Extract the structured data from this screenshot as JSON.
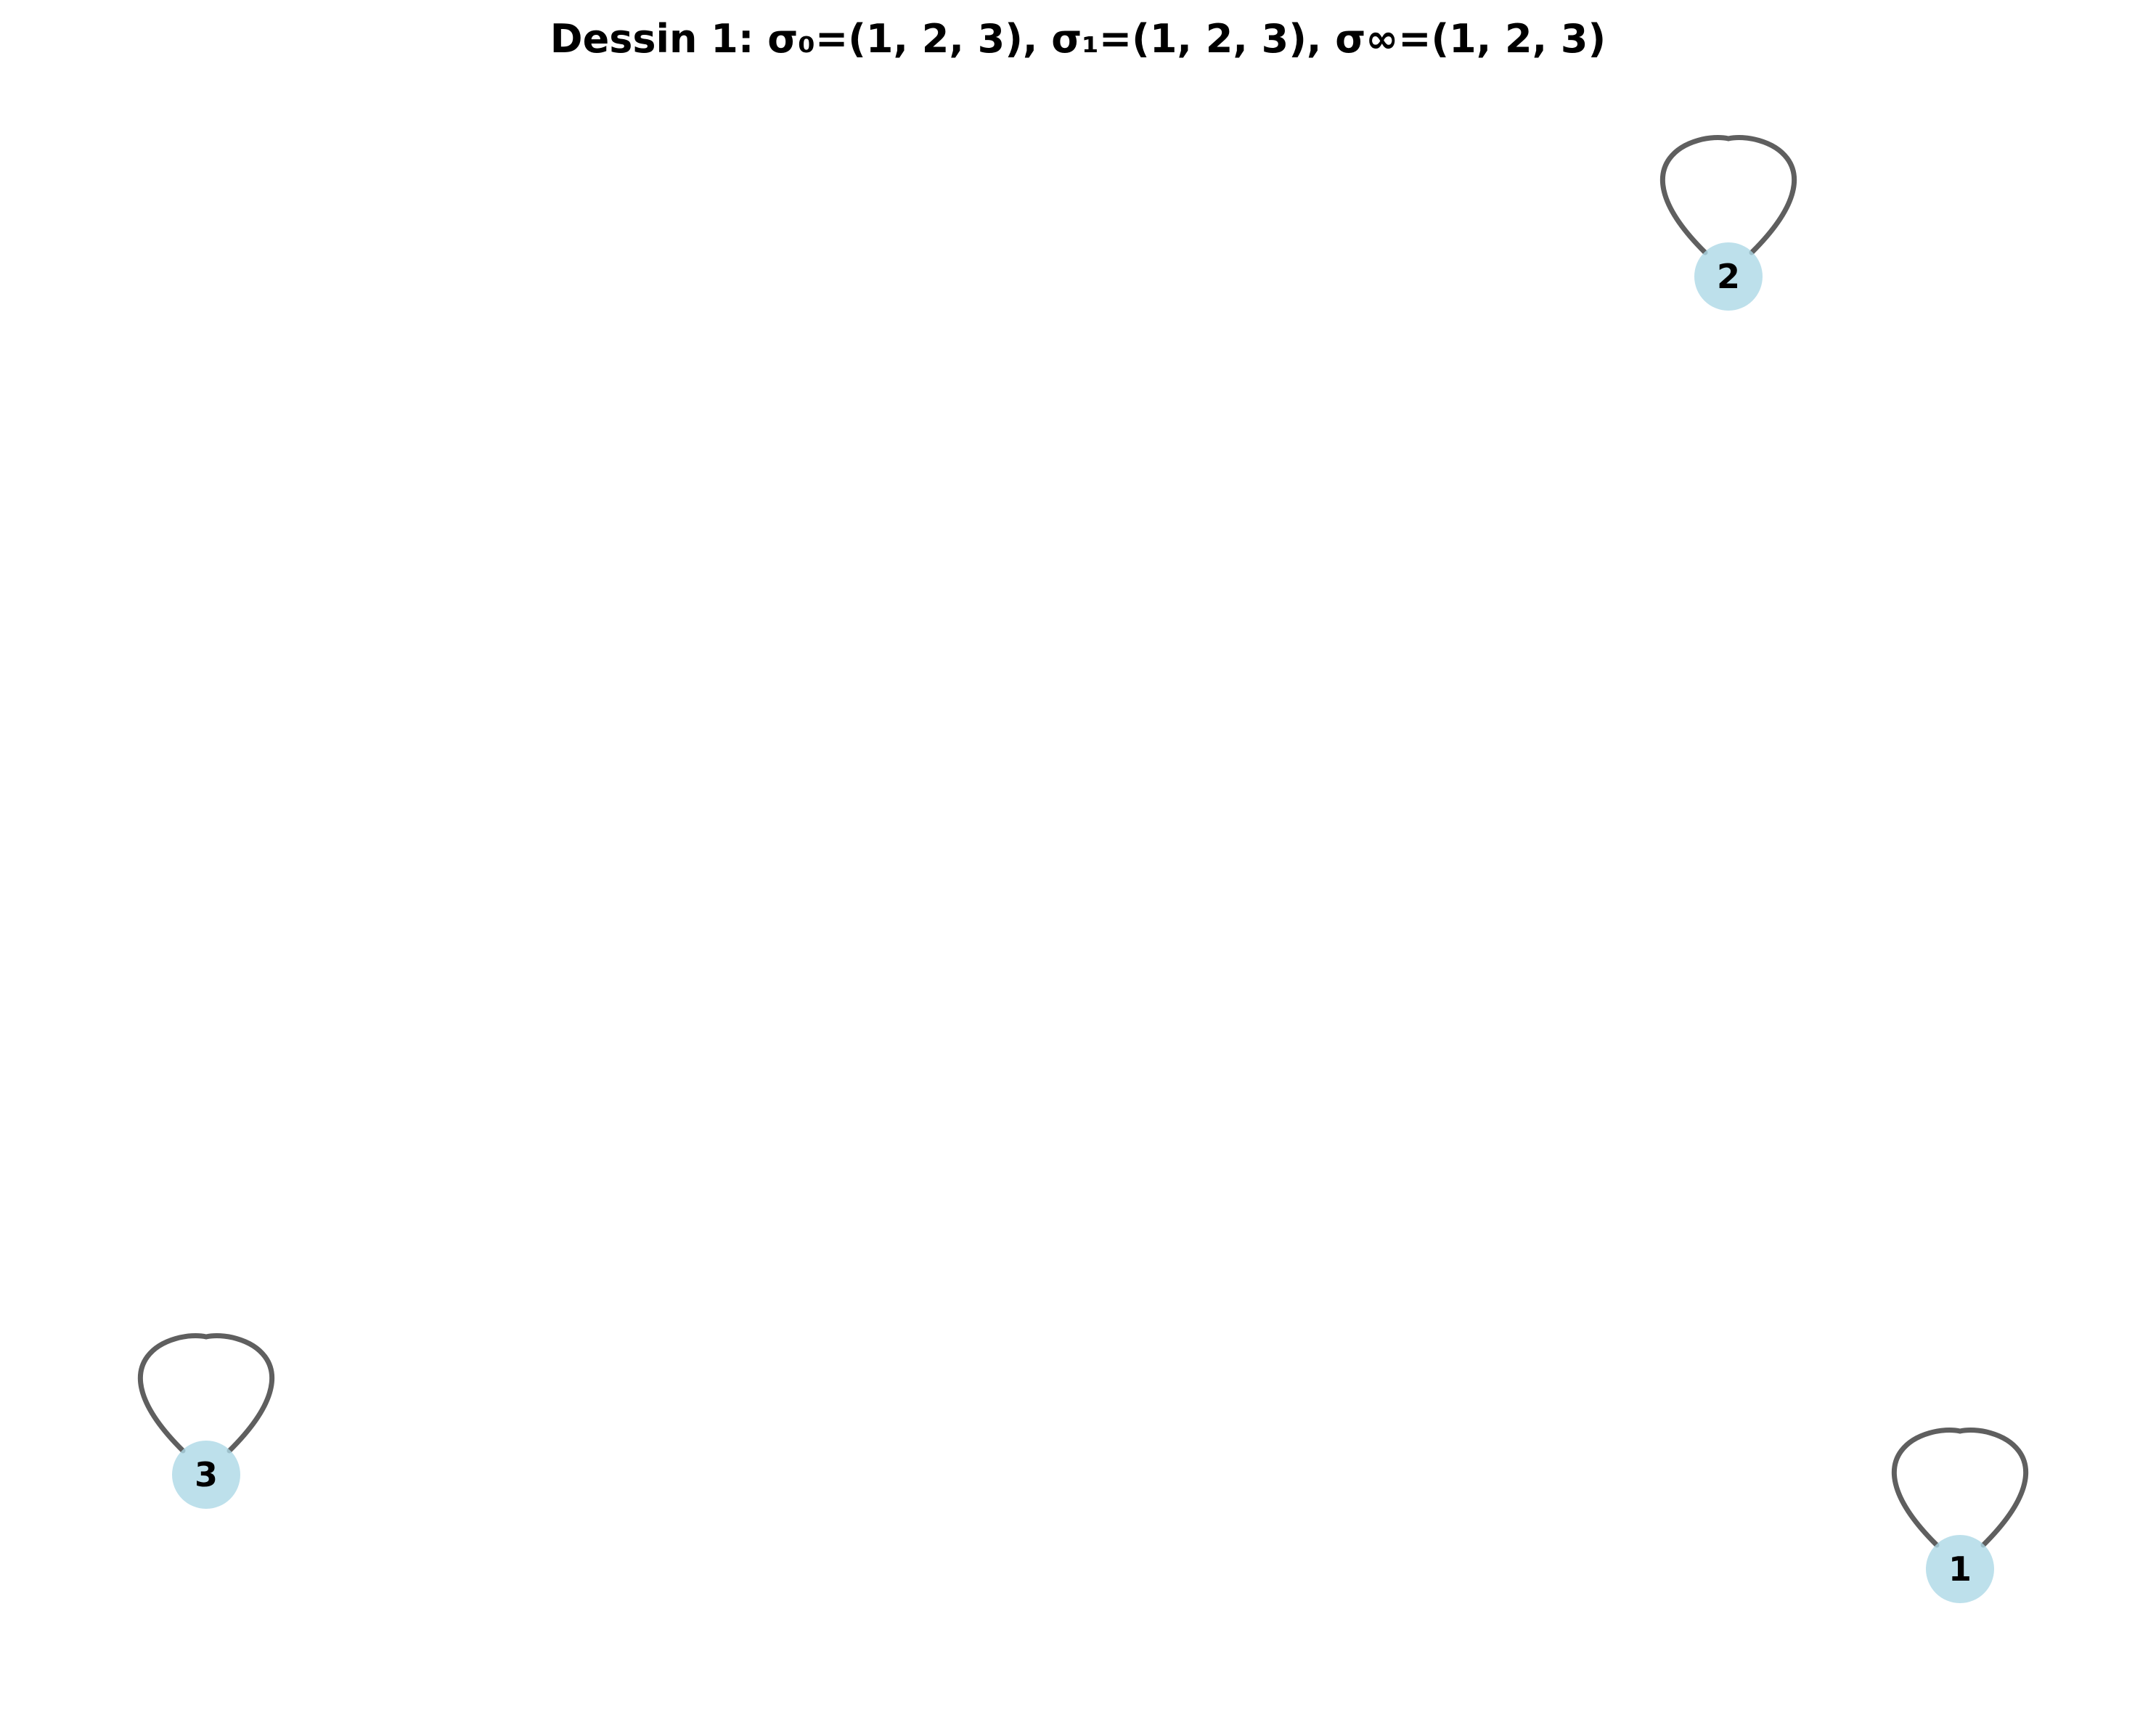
{
  "title": "Dessin 1: σ₀=(1, 2, 3), σ₁=(1, 2, 3), σ∞=(1, 2, 3)",
  "colors": {
    "node_fill": "#add8e6",
    "edge_stroke": "#5f5f5f",
    "text": "#000000"
  },
  "graph": {
    "nodes": [
      {
        "id": "1",
        "label": "1"
      },
      {
        "id": "2",
        "label": "2"
      },
      {
        "id": "3",
        "label": "3"
      }
    ],
    "edges": [
      {
        "source": "1",
        "target": "1",
        "kind": "self-loop"
      },
      {
        "source": "2",
        "target": "2",
        "kind": "self-loop"
      },
      {
        "source": "3",
        "target": "3",
        "kind": "self-loop"
      }
    ]
  }
}
